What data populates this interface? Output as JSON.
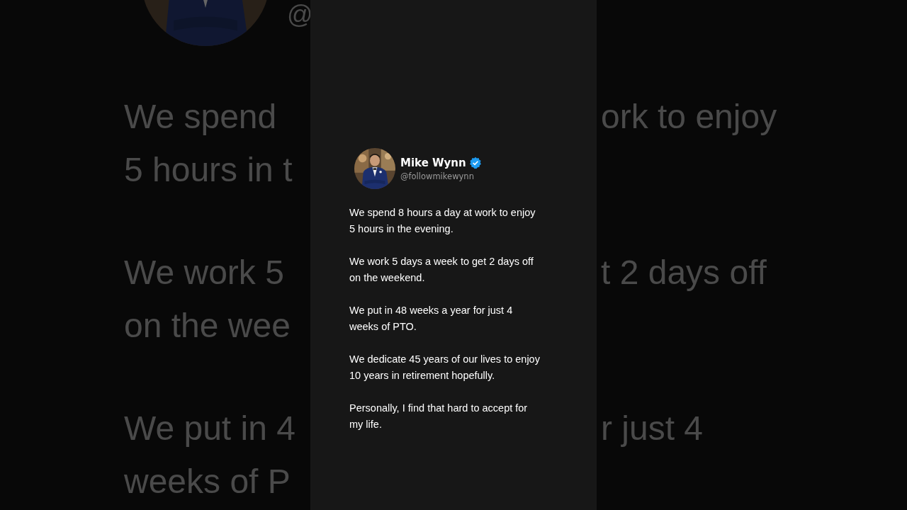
{
  "background": {
    "handle_fragment": "@",
    "left_paragraphs": [
      [
        "We spend",
        "5 hours in t"
      ],
      [
        "We work 5",
        "on the wee"
      ],
      [
        "We put in 4",
        "weeks of P"
      ]
    ],
    "right_lines": [
      "ork to enjoy",
      "t 2 days off",
      "r just 4"
    ]
  },
  "tweet": {
    "name": "Mike Wynn",
    "verified": true,
    "handle": "@followmikewynn",
    "paragraphs": [
      {
        "lines": [
          "We spend 8 hours a day at work to enjoy",
          "5 hours in the evening."
        ]
      },
      {
        "lines": [
          "We work 5 days a week to get 2 days off",
          "on the weekend."
        ]
      },
      {
        "lines": [
          "We put in 48 weeks a year for just 4",
          "weeks of PTO."
        ]
      },
      {
        "lines": [
          "We dedicate 45 years of our lives to enjoy",
          "10 years in retirement hopefully."
        ]
      },
      {
        "lines": [
          "Personally, I find that hard to accept for",
          "my life."
        ]
      }
    ]
  }
}
